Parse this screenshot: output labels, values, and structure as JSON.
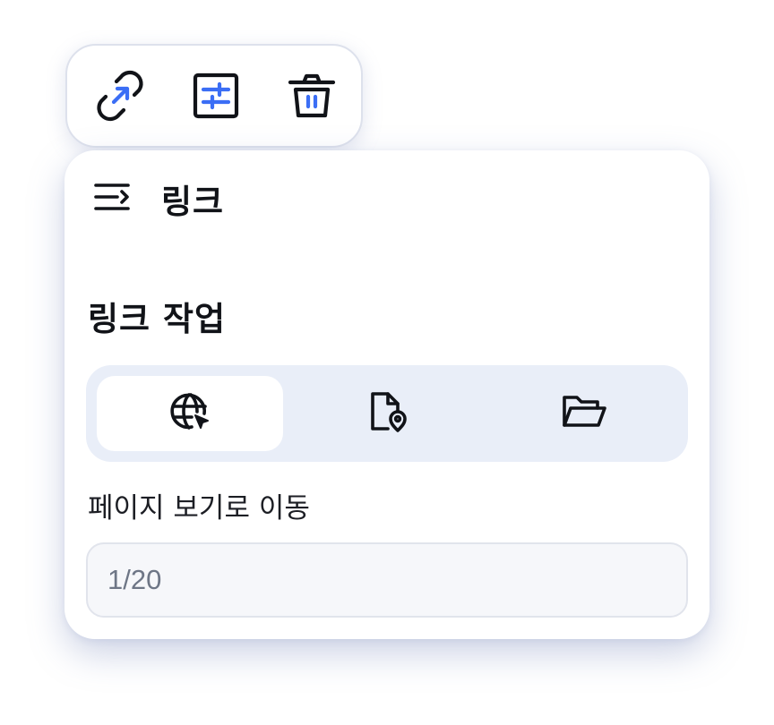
{
  "toolbar": {
    "items": [
      {
        "name": "link-icon"
      },
      {
        "name": "settings-sliders-icon"
      },
      {
        "name": "trash-icon"
      }
    ]
  },
  "panel": {
    "header": {
      "menu_icon": "menu-arrow-icon",
      "title": "링크"
    },
    "section_title": "링크 작업",
    "link_types": [
      {
        "icon": "globe-icon",
        "active": true
      },
      {
        "icon": "file-location-icon",
        "active": false
      },
      {
        "icon": "folder-icon",
        "active": false
      }
    ],
    "field_label": "페이지 보기로 이동",
    "page_input": {
      "value": "",
      "placeholder": "1/20"
    }
  },
  "colors": {
    "accent": "#3b6ef5",
    "icon_dark": "#111318",
    "segment_bg": "#e9eef8",
    "input_bg": "#f6f7fa"
  }
}
